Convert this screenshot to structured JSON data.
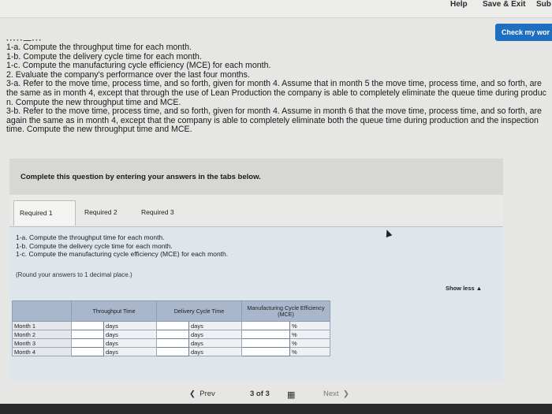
{
  "header": {
    "help": "Help",
    "save_exit": "Save & Exit",
    "sub": "Sub",
    "check_button": "Check my wor"
  },
  "instructions": {
    "lines": [
      "1-a. Compute the throughput time for each month.",
      "1-b. Compute the delivery cycle time for each month.",
      "1-c. Compute the manufacturing cycle efficiency (MCE) for each month.",
      "2. Evaluate the company's performance over the last four months.",
      "3-a. Refer to the move time, process time, and so forth, given for month 4. Assume that in month 5 the move time, process time, and so forth, are the same as in month 4, except that through the use of Lean Production the company is able to completely eliminate the queue time during produc n. Compute the new throughput time and MCE.",
      "3-b. Refer to the move time, process time, and so forth, given for month 4. Assume in month 6 that the move time, process time, and so forth, are again the same as in month 4, except that the company is able to completely eliminate both the queue time during production and the inspection time. Compute the new throughput time and MCE."
    ]
  },
  "complete_prompt": "Complete this question by entering your answers in the tabs below.",
  "tabs": [
    "Required 1",
    "Required 2",
    "Required 3"
  ],
  "panel": {
    "lines": [
      "1-a. Compute the throughput time for each month.",
      "1-b. Compute the delivery cycle time for each month.",
      "1-c. Compute the manufacturing cycle efficiency (MCE) for each month."
    ],
    "note": "(Round your answers to 1 decimal place.)",
    "show_less": "Show less ▲"
  },
  "table": {
    "headers": [
      "",
      "Throughput Time",
      "Delivery Cycle Time",
      "Manufacturing Cycle Efficiency (MCE)"
    ],
    "rows": [
      {
        "label": "Month 1",
        "unit1": "days",
        "unit2": "days",
        "unit3": "%"
      },
      {
        "label": "Month 2",
        "unit1": "days",
        "unit2": "days",
        "unit3": "%"
      },
      {
        "label": "Month 3",
        "unit1": "days",
        "unit2": "days",
        "unit3": "%"
      },
      {
        "label": "Month 4",
        "unit1": "days",
        "unit2": "days",
        "unit3": "%"
      }
    ]
  },
  "nav": {
    "prev": "Prev",
    "page": "3 of 3",
    "next": "Next"
  }
}
